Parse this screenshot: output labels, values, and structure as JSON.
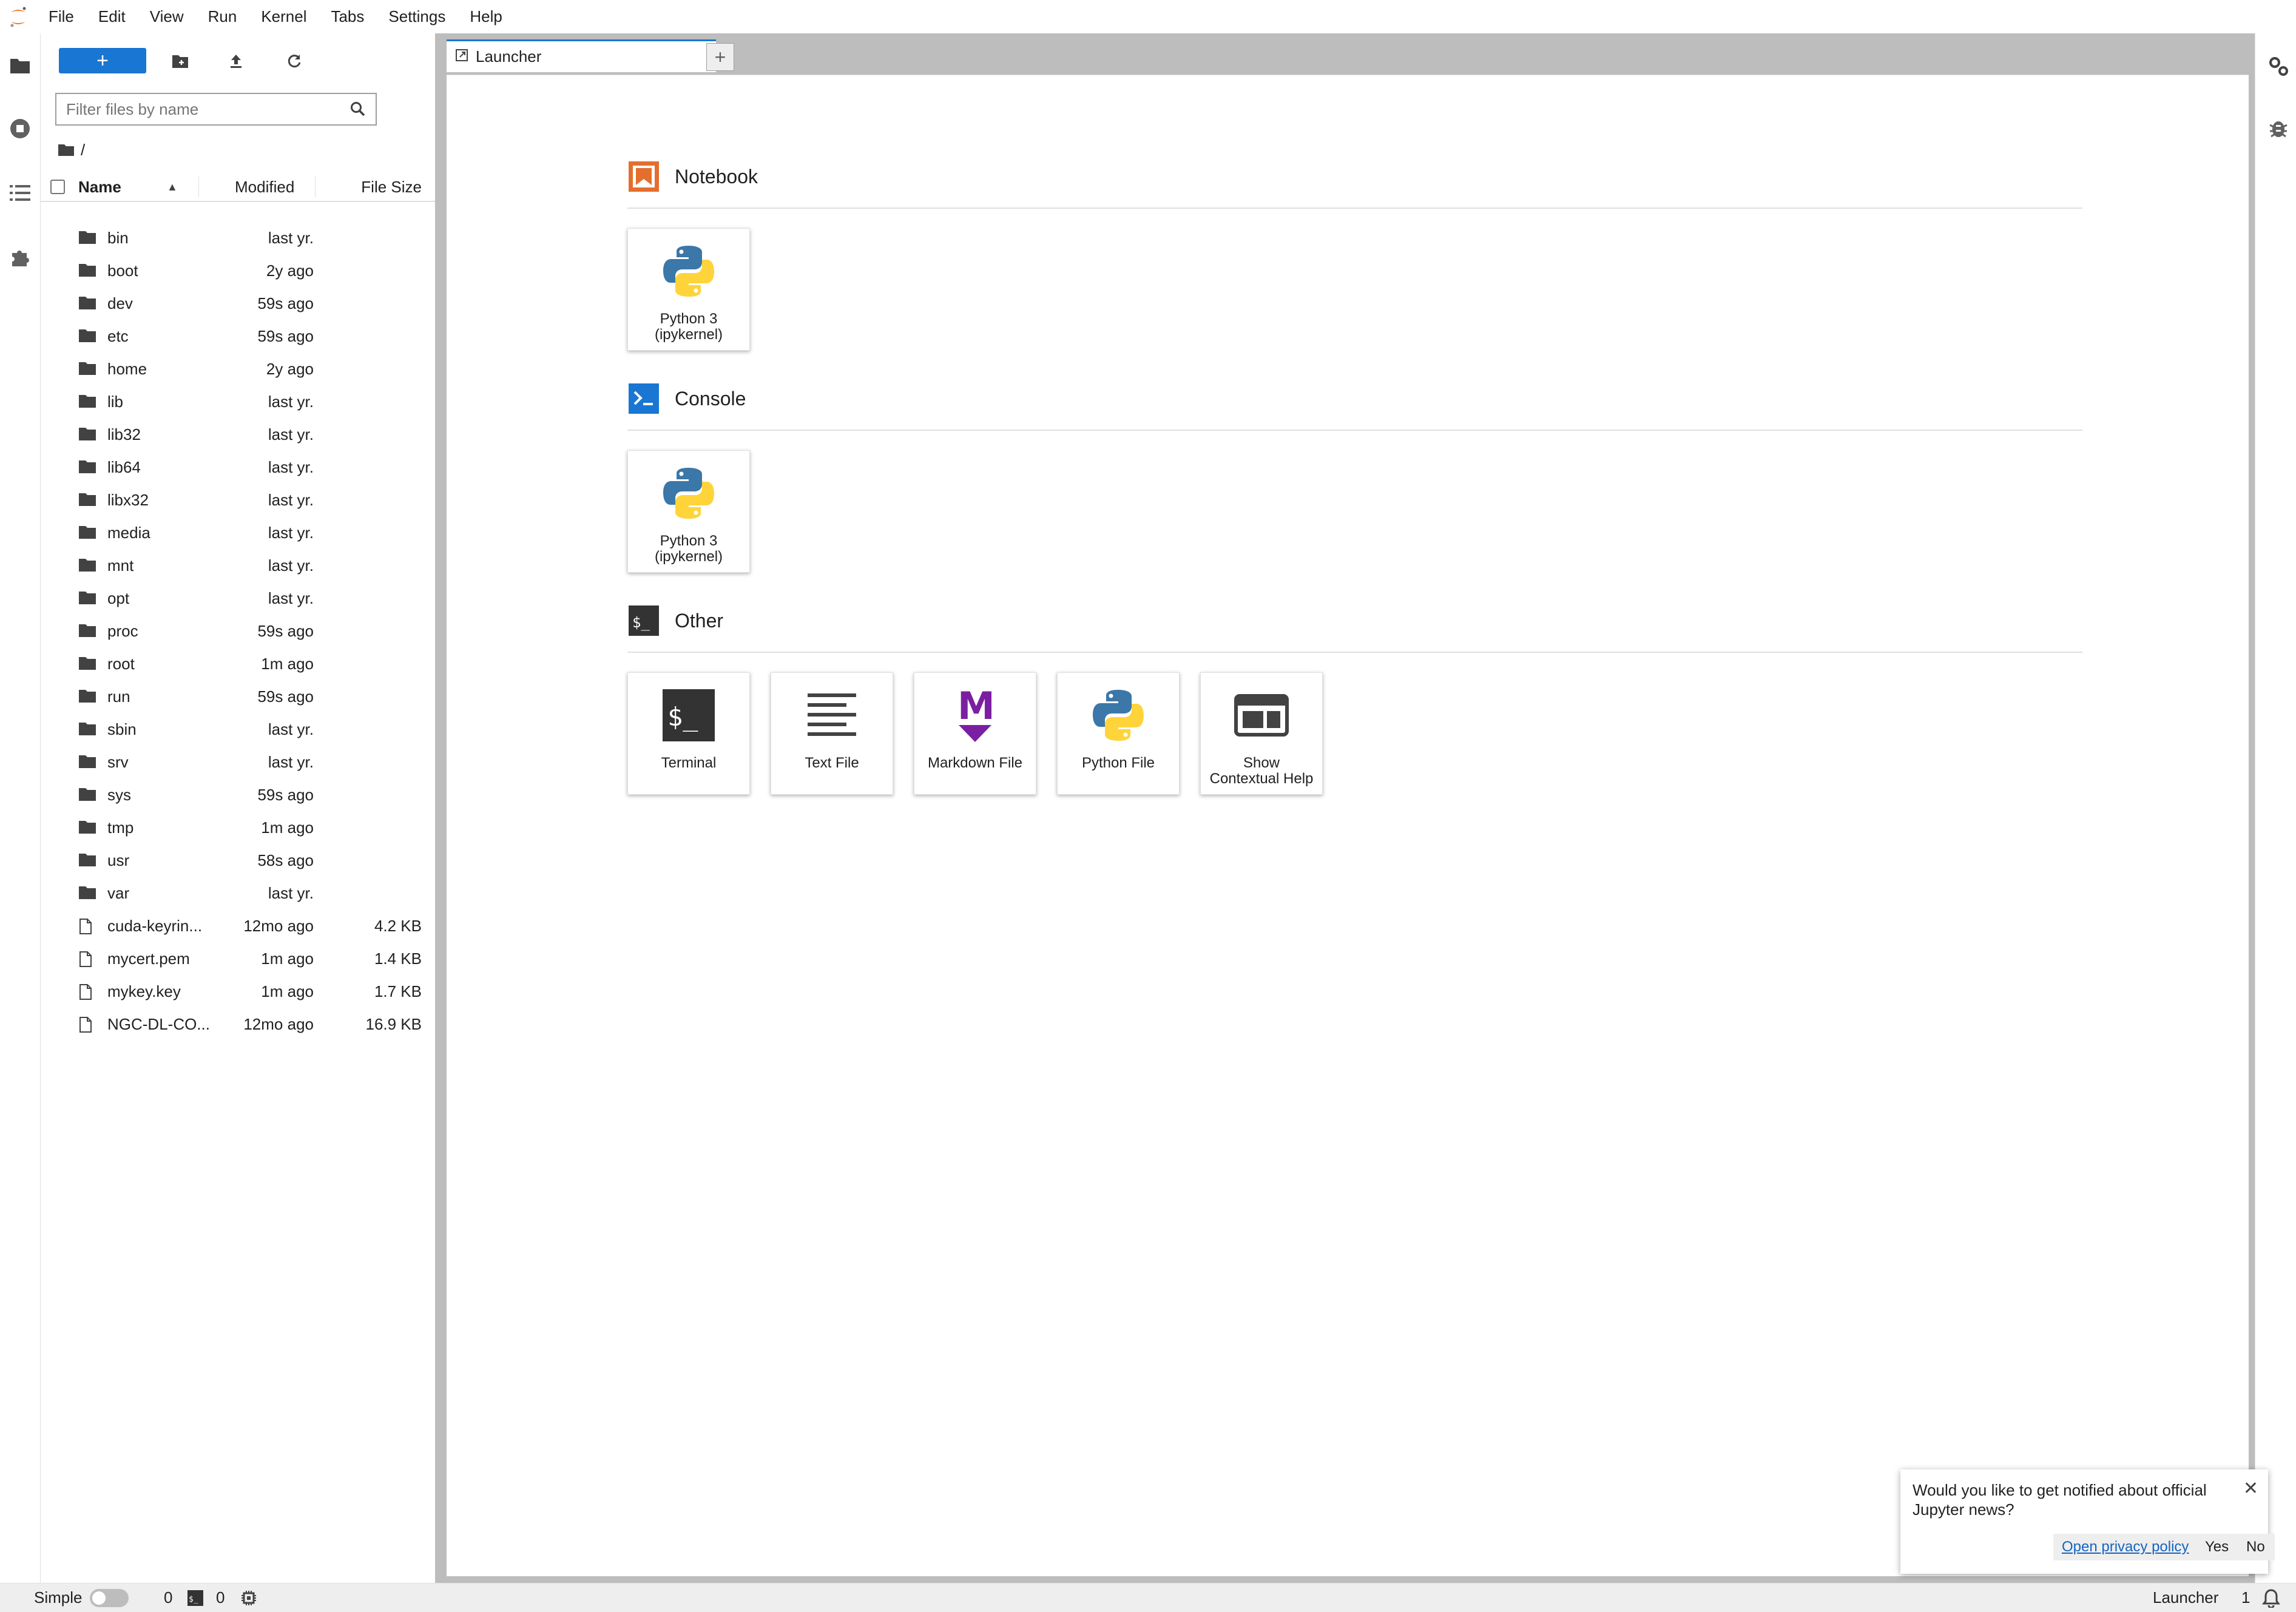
{
  "menubar": {
    "items": [
      "File",
      "Edit",
      "View",
      "Run",
      "Kernel",
      "Tabs",
      "Settings",
      "Help"
    ]
  },
  "filebrowser": {
    "new_label": "+",
    "filter_placeholder": "Filter files by name",
    "breadcrumb": "/",
    "columns": {
      "name": "Name",
      "modified": "Modified",
      "size": "File Size"
    },
    "rows": [
      {
        "type": "folder",
        "name": "bin",
        "modified": "last yr.",
        "size": ""
      },
      {
        "type": "folder",
        "name": "boot",
        "modified": "2y ago",
        "size": ""
      },
      {
        "type": "folder",
        "name": "dev",
        "modified": "59s ago",
        "size": ""
      },
      {
        "type": "folder",
        "name": "etc",
        "modified": "59s ago",
        "size": ""
      },
      {
        "type": "folder",
        "name": "home",
        "modified": "2y ago",
        "size": ""
      },
      {
        "type": "folder",
        "name": "lib",
        "modified": "last yr.",
        "size": ""
      },
      {
        "type": "folder",
        "name": "lib32",
        "modified": "last yr.",
        "size": ""
      },
      {
        "type": "folder",
        "name": "lib64",
        "modified": "last yr.",
        "size": ""
      },
      {
        "type": "folder",
        "name": "libx32",
        "modified": "last yr.",
        "size": ""
      },
      {
        "type": "folder",
        "name": "media",
        "modified": "last yr.",
        "size": ""
      },
      {
        "type": "folder",
        "name": "mnt",
        "modified": "last yr.",
        "size": ""
      },
      {
        "type": "folder",
        "name": "opt",
        "modified": "last yr.",
        "size": ""
      },
      {
        "type": "folder",
        "name": "proc",
        "modified": "59s ago",
        "size": ""
      },
      {
        "type": "folder",
        "name": "root",
        "modified": "1m ago",
        "size": ""
      },
      {
        "type": "folder",
        "name": "run",
        "modified": "59s ago",
        "size": ""
      },
      {
        "type": "folder",
        "name": "sbin",
        "modified": "last yr.",
        "size": ""
      },
      {
        "type": "folder",
        "name": "srv",
        "modified": "last yr.",
        "size": ""
      },
      {
        "type": "folder",
        "name": "sys",
        "modified": "59s ago",
        "size": ""
      },
      {
        "type": "folder",
        "name": "tmp",
        "modified": "1m ago",
        "size": ""
      },
      {
        "type": "folder",
        "name": "usr",
        "modified": "58s ago",
        "size": ""
      },
      {
        "type": "folder",
        "name": "var",
        "modified": "last yr.",
        "size": ""
      },
      {
        "type": "file",
        "name": "cuda-keyrin...",
        "modified": "12mo ago",
        "size": "4.2 KB"
      },
      {
        "type": "file",
        "name": "mycert.pem",
        "modified": "1m ago",
        "size": "1.4 KB"
      },
      {
        "type": "file",
        "name": "mykey.key",
        "modified": "1m ago",
        "size": "1.7 KB"
      },
      {
        "type": "file",
        "name": "NGC-DL-CO...",
        "modified": "12mo ago",
        "size": "16.9 KB"
      }
    ]
  },
  "tabs": {
    "active_label": "Launcher",
    "add_label": "+"
  },
  "launcher": {
    "notebook": {
      "title": "Notebook",
      "cards": [
        {
          "label1": "Python 3",
          "label2": "(ipykernel)"
        }
      ]
    },
    "console": {
      "title": "Console",
      "cards": [
        {
          "label1": "Python 3",
          "label2": "(ipykernel)"
        }
      ]
    },
    "other": {
      "title": "Other",
      "cards": [
        {
          "label1": "Terminal",
          "label2": ""
        },
        {
          "label1": "Text File",
          "label2": ""
        },
        {
          "label1": "Markdown File",
          "label2": ""
        },
        {
          "label1": "Python File",
          "label2": ""
        },
        {
          "label1": "Show",
          "label2": "Contextual Help"
        }
      ]
    }
  },
  "statusbar": {
    "mode_label": "Simple",
    "kernels_count": "0",
    "terminals_count": "0",
    "active_doc": "Launcher",
    "notifications_count": "1"
  },
  "notification": {
    "text": "Would you like to get notified about official Jupyter news?",
    "link": "Open privacy policy",
    "yes": "Yes",
    "no": "No"
  },
  "colors": {
    "accent": "#1976d2",
    "notebook_icon": "#e46e2e",
    "console_icon": "#1976d2",
    "markdown": "#7b1fa2"
  }
}
